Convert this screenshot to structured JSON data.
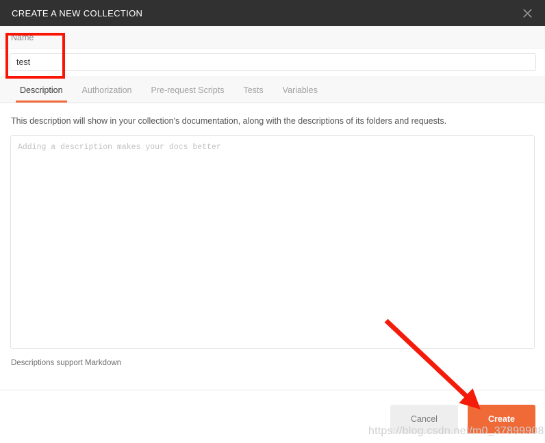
{
  "header": {
    "title": "CREATE A NEW COLLECTION",
    "close_icon": "close-icon"
  },
  "name_field": {
    "label": "Name",
    "value": "test",
    "placeholder": ""
  },
  "tabs": [
    {
      "label": "Description",
      "active": true
    },
    {
      "label": "Authorization",
      "active": false
    },
    {
      "label": "Pre-request Scripts",
      "active": false
    },
    {
      "label": "Tests",
      "active": false
    },
    {
      "label": "Variables",
      "active": false
    }
  ],
  "description_panel": {
    "help_text": "This description will show in your collection's documentation, along with the descriptions of its folders and requests.",
    "textarea_value": "",
    "textarea_placeholder": "Adding a description makes your docs better",
    "markdown_note": "Descriptions support Markdown"
  },
  "footer": {
    "cancel_label": "Cancel",
    "create_label": "Create"
  },
  "watermark": {
    "text": "https://blog.csdn.net/m0_37899908"
  },
  "annotations": {
    "highlight_box_color": "#fa1405",
    "arrow_color": "#f41b0b",
    "arrow_from": "563,468",
    "arrow_to": "692,590"
  },
  "colors": {
    "header_bg": "#313131",
    "accent": "#f06a38",
    "tab_underline": "#f26b3a",
    "cancel_bg": "#eeeeee",
    "panel_bg": "#f8f8f8"
  }
}
